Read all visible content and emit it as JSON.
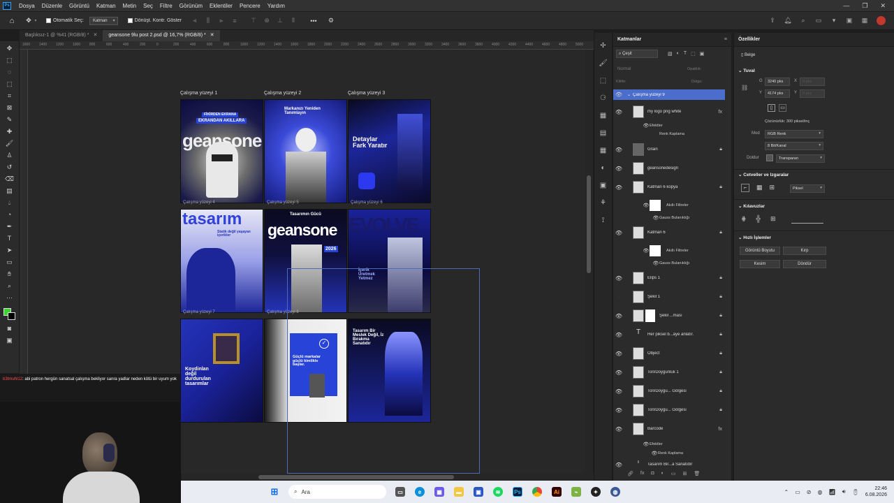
{
  "menubar": {
    "logo": "Ps",
    "items": [
      "Dosya",
      "Düzenle",
      "Görüntü",
      "Katman",
      "Metin",
      "Seç",
      "Filtre",
      "Görünüm",
      "Eklentiler",
      "Pencere",
      "Yardım"
    ],
    "controls": [
      "—",
      "❐",
      "✕"
    ]
  },
  "options": {
    "auto_select_label": "Otomatik Seç:",
    "auto_select_value": "Katman",
    "transform_label": "Dönüşt. Kontr. Göster",
    "more": "•••"
  },
  "tabs": [
    {
      "label": "Başlıksız-1 @ %41 (RGB/8) *",
      "close": "✕"
    },
    {
      "label": "geansone 9lu post 2.psd @ 16,7% (RGB/8) *",
      "close": "✕"
    }
  ],
  "ruler_ticks": [
    "1600",
    "1400",
    "1200",
    "1000",
    "800",
    "600",
    "400",
    "200",
    "0",
    "200",
    "400",
    "600",
    "800",
    "1000",
    "1200",
    "1400",
    "1600",
    "1800",
    "2000",
    "2200",
    "2400",
    "2600",
    "2800",
    "3000",
    "3200",
    "3400",
    "3600",
    "3800",
    "4000",
    "4200",
    "4400",
    "4600",
    "4800",
    "5000"
  ],
  "canvas": {
    "artboard_labels": [
      "Çalışma yüzeyi 1",
      "Çalışma yüzeyi 2",
      "Çalışma yüzeyi 3"
    ],
    "inner_labels": [
      "Çalışma yüzeyi 4",
      "Çalışma yüzeyi 5",
      "Çalışma yüzeyi 6",
      "Çalışma yüzeyi 7",
      "Çalışma yüzeyi 8",
      "Çalışma yüzeyi 9"
    ],
    "posters": {
      "p1_top": "FİKİRDEN EKRANA",
      "p1_band": "EKRANDAN AKILLARA",
      "p1_big": "geansone",
      "p2_title": "Markanızı Yeniden Tanımlayın",
      "p3_title": "Detaylar Fark Yaratır",
      "p4_big": "tasarım",
      "p4_sub": "Statik değil yaşayan içerikler",
      "p5_top": "Tasarımın Gücü",
      "p5_big": "geansone",
      "p5_date": "2026",
      "p6_big": "EVOLVE",
      "p6_sub": "İçerik Üretmek Yetmez",
      "p7_text": "Koydinlan değil durdurulan tasarımlar",
      "p8_text": "Güçlü markalar güçlü kimlikle başlar.",
      "p9_text": "Tasarım Bir Meslek Değil, İz Bırakma Sanatıdır"
    }
  },
  "layers_panel": {
    "title": "Katmanlar",
    "filter_label": "Çeşit",
    "blend_mode": "Normal",
    "opacity_label": "Opaklık:",
    "lock_label": "Kilitle:",
    "fill_label": "Dolgu:",
    "layers": [
      {
        "name": "Çalışma yüzeyi 9",
        "selected": true
      },
      {
        "name": "my logo png white",
        "fx": "fx"
      },
      {
        "name": "Grain"
      },
      {
        "name": "geansonedesign"
      },
      {
        "name": "Katman 6 kopya"
      },
      {
        "name": "Katman 6"
      },
      {
        "name": "Elips 1"
      },
      {
        "name": "Şekil 1"
      },
      {
        "name": "Şekil ...ması"
      },
      {
        "name": "Her piksel b...äye anlatır."
      },
      {
        "name": "Object"
      },
      {
        "name": "Ton/Doygunluk 1"
      },
      {
        "name": "Ton/Doygu... Gölgesi"
      },
      {
        "name": "Ton/Doygu... Gölgesi"
      },
      {
        "name": "Barcode",
        "fx": "fx"
      },
      {
        "name": "Tasarım Bir...a Sanatıdır"
      }
    ],
    "effects": "Efektler",
    "color_overlay": "Renk Kaplama",
    "smart_filters": "Akıllı Filtreler",
    "gaussian": "Gauss Bulanıklığı"
  },
  "properties": {
    "title": "Özellikler",
    "doc_label": "Belge",
    "canvas_section": "Tuval",
    "width_label": "G",
    "width": "3240 pks",
    "height_label": "Y",
    "height": "4174 pks",
    "x_label": "X",
    "y_label": "Y",
    "x_val": "0 pks",
    "y_val": "0 pks",
    "resolution": "Çözünürlük: 300 piksel/inç",
    "mode_label": "Mod",
    "mode": "RGB Renk",
    "bit_depth": "8 Bit/Kanal",
    "fill_label": "Doldur",
    "fill": "Transparan",
    "rulers_section": "Cetveller ve Izgaralar",
    "units": "Piksel",
    "guides_section": "Kılavuzlar",
    "quick_section": "Hızlı İşlemler",
    "btn_resize": "Görüntü Boyutu",
    "btn_crop": "Kırp",
    "btn_trim": "Kesim",
    "btn_rotate": "Döndür"
  },
  "chat": {
    "user": "b3tmuhl12",
    "message": ": abi patron hergün sanatsal çalışma bekliyor sanra yadlar neden kötü bir uyum yok"
  },
  "taskbar": {
    "search": "Ara",
    "time": "22:46",
    "date": "6.08.2026"
  }
}
